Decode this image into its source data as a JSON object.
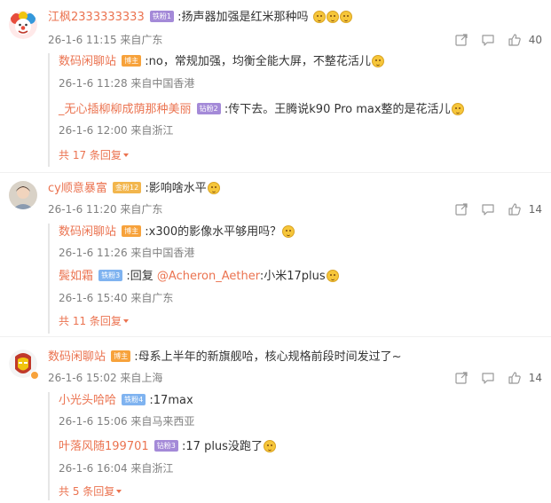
{
  "comments": [
    {
      "user": "江枫2333333333",
      "badge": "铁粉1",
      "text": ":扬声器加强是红米那种吗",
      "time": "26-1-6 11:15 来自广东",
      "likes": "40",
      "replies": [
        {
          "user": "数码闲聊站",
          "badge": "博主",
          "text": ":no，常规加强，均衡全能大屏，不整花活儿",
          "time": "26-1-6 11:28 来自中国香港"
        },
        {
          "user": "_无心插柳柳成荫那种美丽",
          "badge": "钻粉2",
          "text": ":传下去。王腾说k90 Pro max整的是花活儿",
          "time": "26-1-6 12:00 来自浙江"
        }
      ],
      "more": "共 17 条回复"
    },
    {
      "user": "cy顺意暴富",
      "badge": "金粉12",
      "text": ":影响啥水平",
      "time": "26-1-6 11:20 来自广东",
      "likes": "14",
      "replies": [
        {
          "user": "数码闲聊站",
          "badge": "博主",
          "text": ":x300的影像水平够用吗？",
          "time": "26-1-6 11:26 来自中国香港"
        },
        {
          "user": "鬓如霜",
          "badge": "铁粉3",
          "text_prefix": ":回复 ",
          "mention": "@Acheron_Aether",
          "text": ":小米17plus",
          "time": "26-1-6 15:40 来自广东"
        }
      ],
      "more": "共 11 条回复"
    },
    {
      "user": "数码闲聊站",
      "badge": "博主",
      "text": ":母系上半年的新旗舰哈，核心规格前段时间发过了~",
      "time": "26-1-6 15:02 来自上海",
      "likes": "14",
      "replies": [
        {
          "user": "小光头哈哈",
          "badge": "铁粉4",
          "text": ":17max",
          "time": "26-1-6 15:06 来自马来西亚"
        },
        {
          "user": "叶落风随199701",
          "badge": "钻粉3",
          "text": ":17 plus没跑了",
          "time": "26-1-6 16:04 来自浙江"
        }
      ],
      "more": "共 5 条回复"
    }
  ],
  "icons": [
    "share-icon",
    "comment-icon",
    "like-icon"
  ],
  "colors": {
    "username": "#eb7350",
    "meta": "#808080",
    "badge_purple": "#a48ad8",
    "badge_blue": "#7fb3f0",
    "badge_gold": "#f2b64d",
    "badge_orange": "#f7a23b"
  }
}
